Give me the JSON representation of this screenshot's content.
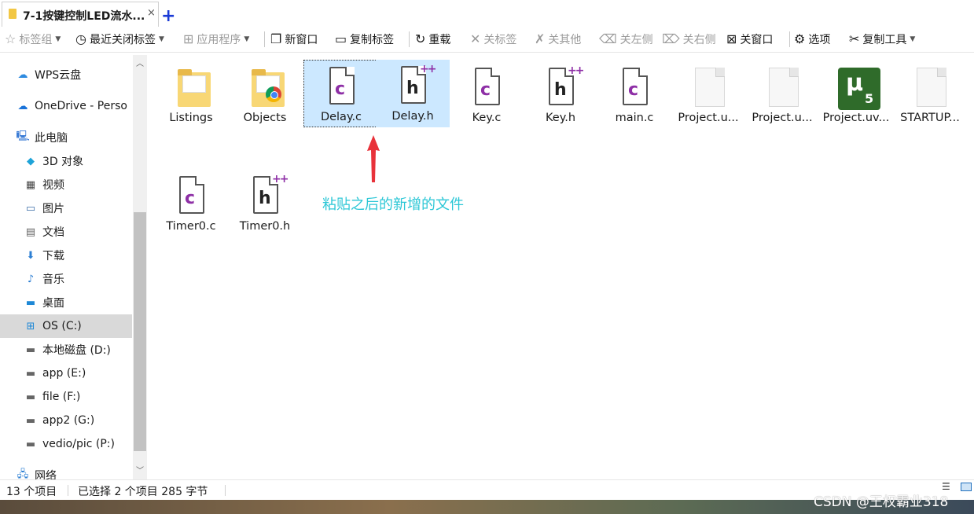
{
  "tab": {
    "title": "7-1按键控制LED流水...",
    "close": "×",
    "new": "+"
  },
  "toolbar": {
    "bookmarks": "标签组",
    "recent": "最近关闭标签",
    "apps": "应用程序",
    "new_window": "新窗口",
    "copy_tab": "复制标签",
    "reload": "重载",
    "close_tab": "关标签",
    "close_others": "关其他",
    "close_left": "关左侧",
    "close_right": "关右侧",
    "close_window": "关窗口",
    "options": "选项",
    "copy_tools": "复制工具"
  },
  "nav": [
    {
      "label": "WPS云盘",
      "icon": "cloud-icon"
    },
    {
      "label": "OneDrive - Perso",
      "icon": "onedrive-icon"
    },
    {
      "label": "此电脑",
      "icon": "computer-icon"
    },
    {
      "label": "3D 对象",
      "icon": "3d-objects-icon"
    },
    {
      "label": "视频",
      "icon": "video-icon"
    },
    {
      "label": "图片",
      "icon": "pictures-icon"
    },
    {
      "label": "文档",
      "icon": "documents-icon"
    },
    {
      "label": "下载",
      "icon": "download-icon"
    },
    {
      "label": "音乐",
      "icon": "music-icon"
    },
    {
      "label": "桌面",
      "icon": "desktop-icon"
    },
    {
      "label": "OS (C:)",
      "icon": "windows-drive-icon"
    },
    {
      "label": "本地磁盘 (D:)",
      "icon": "drive-icon"
    },
    {
      "label": "app (E:)",
      "icon": "drive-icon"
    },
    {
      "label": "file (F:)",
      "icon": "drive-icon"
    },
    {
      "label": "app2 (G:)",
      "icon": "drive-icon"
    },
    {
      "label": "vedio/pic (P:)",
      "icon": "drive-icon"
    },
    {
      "label": "网络",
      "icon": "network-icon"
    }
  ],
  "files": [
    {
      "name": "Listings",
      "type": "folder"
    },
    {
      "name": "Objects",
      "type": "folder-chrome"
    },
    {
      "name": "Delay.c",
      "type": "c"
    },
    {
      "name": "Delay.h",
      "type": "h"
    },
    {
      "name": "Key.c",
      "type": "c"
    },
    {
      "name": "Key.h",
      "type": "h"
    },
    {
      "name": "main.c",
      "type": "c"
    },
    {
      "name": "Project.u...",
      "type": "blank"
    },
    {
      "name": "Project.u...",
      "type": "blank"
    },
    {
      "name": "Project.uv...",
      "type": "uvision"
    },
    {
      "name": "STARTUP...",
      "type": "blank"
    },
    {
      "name": "Timer0.c",
      "type": "c"
    },
    {
      "name": "Timer0.h",
      "type": "h"
    }
  ],
  "annotation": "粘贴之后的新增的文件",
  "status": {
    "count": "13 个项目",
    "selection": "已选择 2 个项目  285 字节"
  },
  "watermark": "CSDN @王权霸业318",
  "colors": {
    "selection": "#cce8ff",
    "annotation": "#2cc7d6",
    "arrow": "#e8323a",
    "c_letter": "#8e2fa6"
  }
}
